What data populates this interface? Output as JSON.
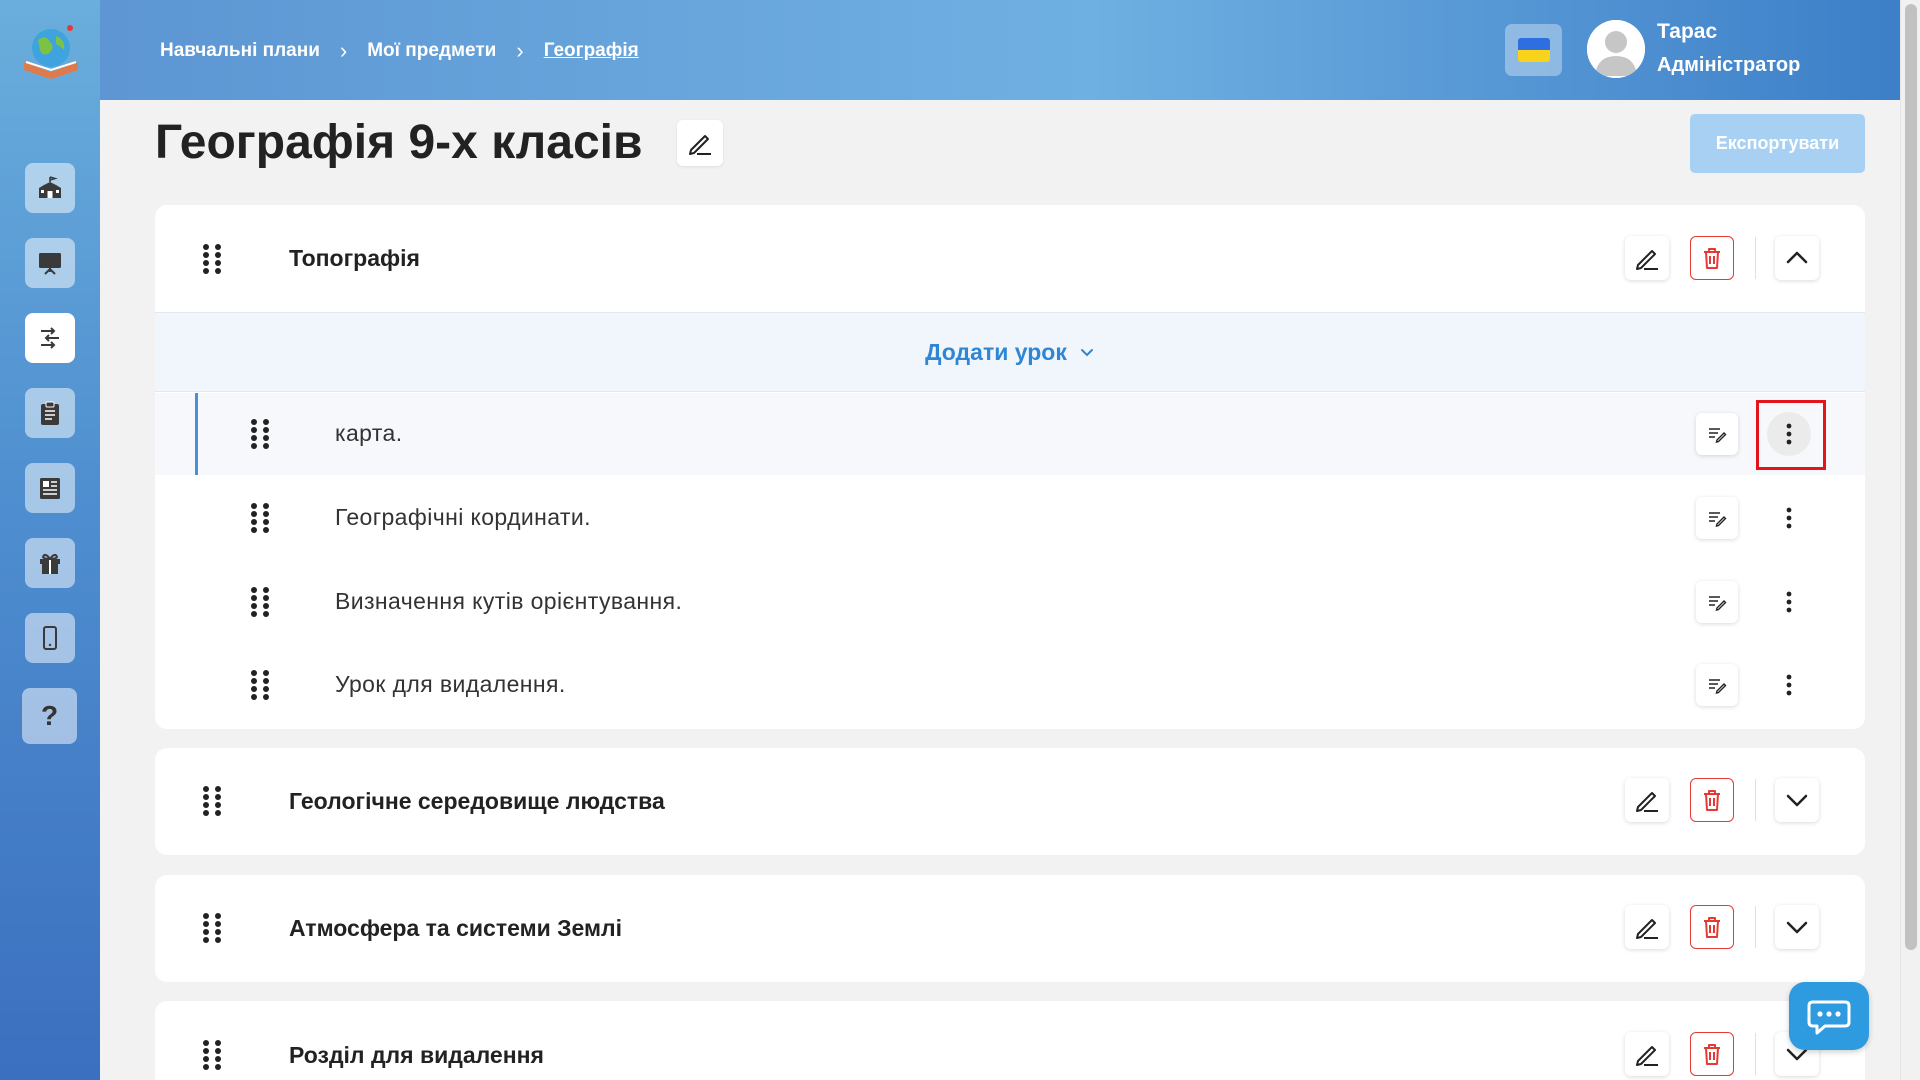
{
  "breadcrumbs": {
    "item1": "Навчальні плани",
    "item2": "Мої предмети",
    "current": "Географія",
    "separator": "›"
  },
  "user": {
    "name": "Тарас",
    "role": "Адміністратор"
  },
  "page": {
    "title": "Географія 9-х класів",
    "export_label": "Експортувати"
  },
  "add_lesson_label": "Додати урок",
  "sections": [
    {
      "title": "Топографія",
      "expanded": true,
      "lessons": [
        {
          "title": "карта."
        },
        {
          "title": "Географічні кординати."
        },
        {
          "title": "Визначення кутів орієнтування."
        },
        {
          "title": "Урок для видалення."
        }
      ]
    },
    {
      "title": "Геологічне середовище людства",
      "expanded": false
    },
    {
      "title": "Атмосфера та системи Землі",
      "expanded": false
    },
    {
      "title": "Розділ для видалення",
      "expanded": false
    }
  ],
  "sidebar": {
    "items": [
      "school-icon",
      "presentation-icon",
      "curriculum-icon",
      "clipboard-icon",
      "newspaper-icon",
      "gift-icon",
      "phone-icon",
      "help-icon"
    ],
    "help_label": "?"
  },
  "colors": {
    "accent": "#2e86d4",
    "delete": "#e53935",
    "highlight": "#e3141b",
    "sidebar_top": "#6aaedc",
    "sidebar_bottom": "#3b6fbf"
  }
}
